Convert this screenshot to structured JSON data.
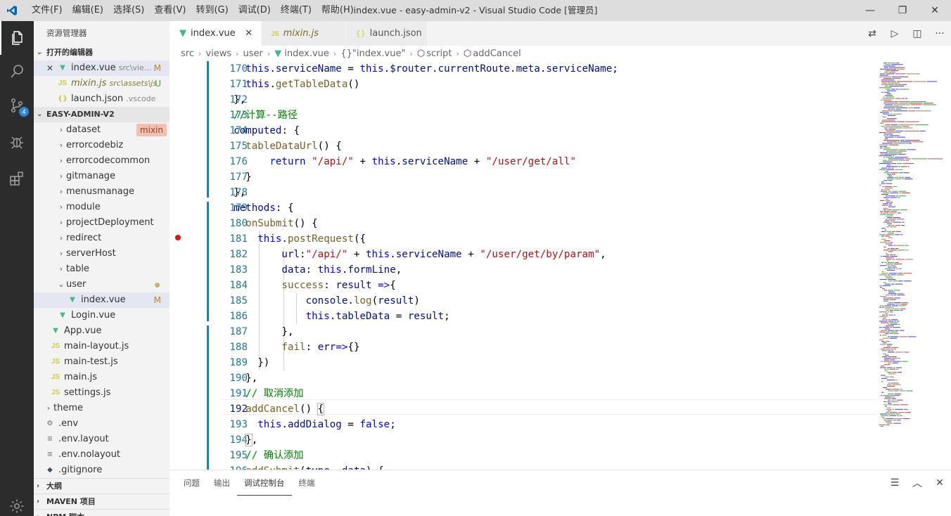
{
  "window": {
    "title": "index.vue - easy-admin-v2 - Visual Studio Code [管理员]",
    "menu": [
      "文件(F)",
      "编辑(E)",
      "选择(S)",
      "查看(V)",
      "转到(G)",
      "调试(D)",
      "终端(T)",
      "帮助(H)"
    ],
    "controls": {
      "minimize": "—",
      "restore": "❐",
      "close": "✕"
    }
  },
  "activity_bar": {
    "source_control_badge": "4"
  },
  "sidebar": {
    "title": "资源管理器",
    "open_editors_header": "打开的编辑器",
    "open_editors": [
      {
        "close": "✕",
        "icon": "vue",
        "name": "index.vue",
        "desc": "src\\vie...",
        "status": "M",
        "selected": true
      },
      {
        "icon": "js",
        "name": "mixin.js",
        "desc": "src\\assets\\js",
        "status": "U"
      },
      {
        "icon": "json",
        "name": "launch.json",
        "desc": ".vscode"
      }
    ],
    "project_header": "EASY-ADMIN-V2",
    "tree": [
      {
        "type": "folder",
        "name": "dataset",
        "depth": 1,
        "tag": "mixin"
      },
      {
        "type": "folder",
        "name": "errorcodebiz",
        "depth": 1
      },
      {
        "type": "folder",
        "name": "errorcodecommon",
        "depth": 1
      },
      {
        "type": "folder",
        "name": "gitmanage",
        "depth": 1
      },
      {
        "type": "folder",
        "name": "menusmanage",
        "depth": 1
      },
      {
        "type": "folder",
        "name": "module",
        "depth": 1
      },
      {
        "type": "folder",
        "name": "projectDeployment",
        "depth": 1
      },
      {
        "type": "folder",
        "name": "redirect",
        "depth": 1
      },
      {
        "type": "folder",
        "name": "serverHost",
        "depth": 1
      },
      {
        "type": "folder",
        "name": "table",
        "depth": 1
      },
      {
        "type": "folder-open",
        "name": "user",
        "depth": 1,
        "dot": true
      },
      {
        "type": "vue",
        "name": "index.vue",
        "depth": 2,
        "status": "M",
        "selected": true
      },
      {
        "type": "vue",
        "name": "Login.vue",
        "depth": 1
      },
      {
        "type": "vue",
        "name": "App.vue",
        "depth": 0
      },
      {
        "type": "js",
        "name": "main-layout.js",
        "depth": 0
      },
      {
        "type": "js",
        "name": "main-test.js",
        "depth": 0
      },
      {
        "type": "js",
        "name": "main.js",
        "depth": 0
      },
      {
        "type": "js",
        "name": "settings.js",
        "depth": 0
      },
      {
        "type": "folder",
        "name": "theme",
        "depth": -1
      },
      {
        "type": "gear",
        "name": ".env",
        "depth": -1
      },
      {
        "type": "lines",
        "name": ".env.layout",
        "depth": -1
      },
      {
        "type": "lines",
        "name": ".env.nolayout",
        "depth": -1
      },
      {
        "type": "git",
        "name": ".gitignore",
        "depth": -1
      }
    ],
    "bottom_sections": [
      "大纲",
      "MAVEN 项目",
      "NPM 脚本"
    ]
  },
  "tabs": [
    {
      "icon": "vue",
      "label": "index.vue",
      "active": true,
      "close": "✕"
    },
    {
      "icon": "js",
      "label": "mixin.js",
      "italic": true
    },
    {
      "icon": "json",
      "label": "launch.json"
    }
  ],
  "editor_actions": [
    "⇄",
    "▷",
    "◫",
    "···"
  ],
  "breadcrumbs": [
    "src",
    "views",
    "user",
    "index.vue",
    "{}\"index.vue\"",
    "script",
    "addCancel"
  ],
  "editor": {
    "line_numbers": [
      "170",
      "171",
      "172",
      "173",
      "174",
      "175",
      "176",
      "177",
      "178",
      "179",
      "180",
      "181",
      "182",
      "183",
      "184",
      "185",
      "186",
      "187",
      "188",
      "189",
      "190",
      "191",
      "192",
      "193",
      "194",
      "195",
      "196"
    ],
    "breakpoint_line": "181",
    "current_line": "192"
  },
  "panel": {
    "tabs": [
      "问题",
      "输出",
      "调试控制台",
      "终端"
    ],
    "active_tab": "调试控制台",
    "actions": [
      "☰",
      "︿",
      "✕"
    ]
  }
}
